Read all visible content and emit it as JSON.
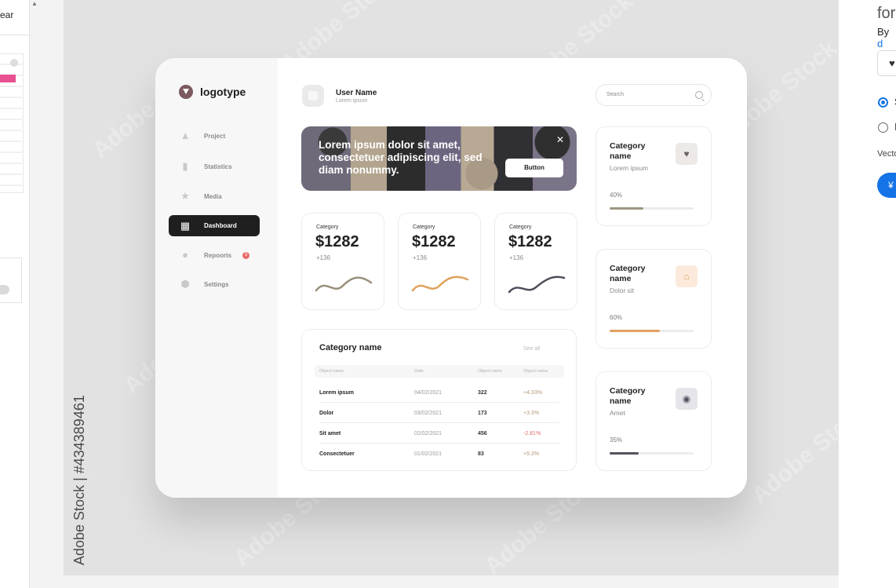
{
  "left_panel": {
    "label": "ear"
  },
  "stage": {
    "watermark": "Adobe Stock",
    "vertical_caption": "Adobe Stock | #434389461"
  },
  "dashboard": {
    "logo": "logotype",
    "nav": [
      {
        "label": "Project",
        "icon": "triangle-icon"
      },
      {
        "label": "Statistics",
        "icon": "bar-chart-icon"
      },
      {
        "label": "Media",
        "icon": "star-icon"
      },
      {
        "label": "Dashboard",
        "icon": "dashboard-icon",
        "active": true
      },
      {
        "label": "Repoorts",
        "icon": "circle-icon",
        "badge": "3"
      },
      {
        "label": "Settings",
        "icon": "gear-icon"
      }
    ],
    "user": {
      "name": "User Name",
      "subtitle": "Lorem ipsum"
    },
    "search": {
      "placeholder": "Search"
    },
    "banner": {
      "text": "Lorem ipsum dolor sit amet, consectetuer adipiscing elit, sed diam nonummy.",
      "button": "Button",
      "close": "✕"
    },
    "stats": [
      {
        "category": "Category",
        "value": "$1282",
        "delta": "+136",
        "line_color": "#9a8f7c"
      },
      {
        "category": "Category",
        "value": "$1282",
        "delta": "+136",
        "line_color": "#e0a25c"
      },
      {
        "category": "Category",
        "value": "$1282",
        "delta": "+136",
        "line_color": "#4f4d5a"
      }
    ],
    "table": {
      "title": "Category name",
      "see_all": "See all",
      "headers": [
        "Object name",
        "Date",
        "Object name",
        "Object name"
      ],
      "rows": [
        {
          "name": "Lorem ipsum",
          "date": "04/02/2021",
          "value": "322",
          "change": "+4.33%",
          "positive": true
        },
        {
          "name": "Dolor",
          "date": "03/02/2021",
          "value": "173",
          "change": "+3.3%",
          "positive": true
        },
        {
          "name": "Sit amet",
          "date": "02/02/2021",
          "value": "456",
          "change": "-2.81%",
          "positive": false
        },
        {
          "name": "Consectetuer",
          "date": "01/02/2021",
          "value": "83",
          "change": "+5.3%",
          "positive": true
        }
      ]
    },
    "cards": [
      {
        "title": "Category name",
        "subtitle": "Lorem ipsum",
        "percent": "40%",
        "progress": 0.4,
        "icon": "♥",
        "icon_name": "heart-icon",
        "color": "#9c9682",
        "icon_bg": "#ece9e6",
        "icon_color": "#6a5f60"
      },
      {
        "title": "Category name",
        "subtitle": "Dolor sit",
        "percent": "60%",
        "progress": 0.6,
        "icon": "⌂",
        "icon_name": "home-icon",
        "color": "#e2a15f",
        "icon_bg": "#fbeadb",
        "icon_color": "#e2a15f"
      },
      {
        "title": "Category name",
        "subtitle": "Amet",
        "percent": "35%",
        "progress": 0.35,
        "icon": "◉",
        "icon_name": "camera-icon",
        "color": "#55525f",
        "icon_bg": "#e6e5ea",
        "icon_color": "#55525f"
      }
    ]
  },
  "right_panel": {
    "title": "for",
    "by": "By",
    "by_link": "d",
    "radio1": "S",
    "radio2": "I",
    "vector_label": "Vecto",
    "buy_label": "¥"
  }
}
